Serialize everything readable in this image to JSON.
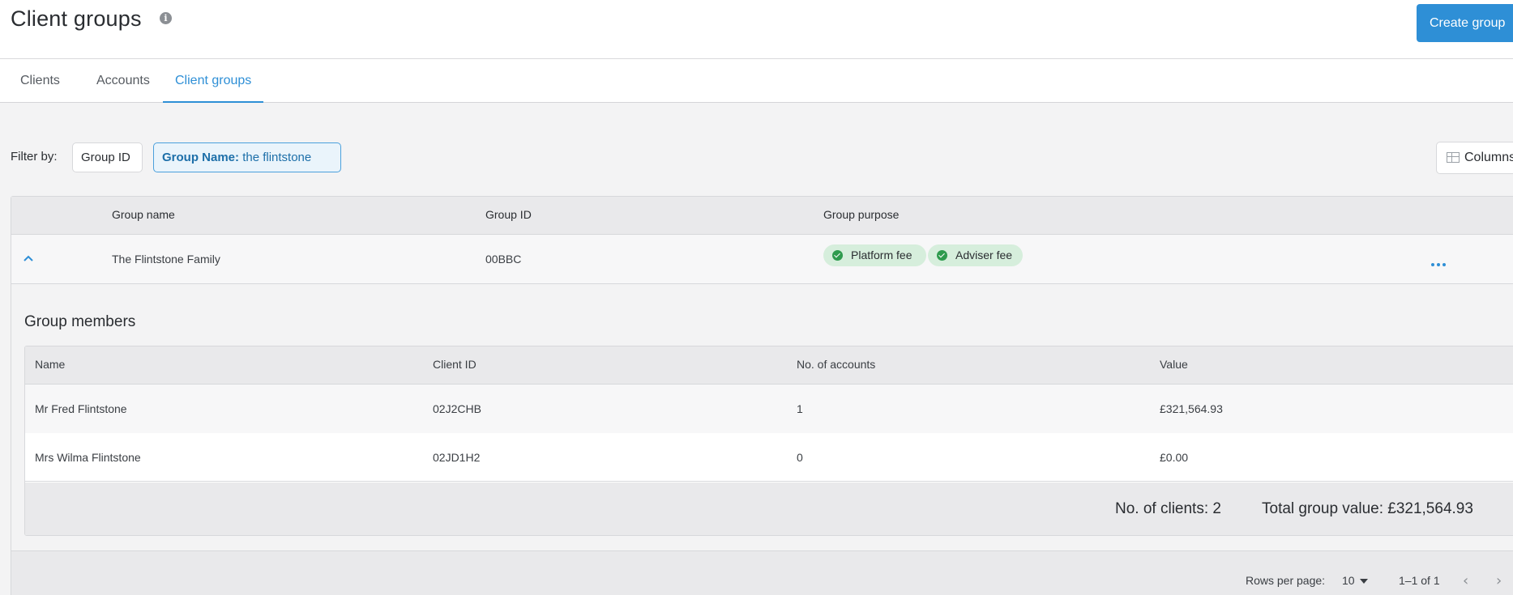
{
  "header": {
    "title": "Client groups",
    "info_icon": "info-icon",
    "create_label": "Create group"
  },
  "tabs": [
    {
      "label": "Clients"
    },
    {
      "label": "Accounts"
    },
    {
      "label": "Client groups",
      "active": true
    }
  ],
  "filters": {
    "label": "Filter by:",
    "chips": [
      {
        "label": "Group ID"
      },
      {
        "key": "Group Name:",
        "value": "the flintstone"
      }
    ],
    "columns_label": "Columns"
  },
  "table": {
    "headers": [
      "Group name",
      "Group ID",
      "Group purpose"
    ],
    "group": {
      "name": "The Flintstone Family",
      "id": "00BBC",
      "purposes": [
        "Platform fee",
        "Adviser fee"
      ]
    }
  },
  "members": {
    "title": "Group members",
    "headers": [
      "Name",
      "Client ID",
      "No. of accounts",
      "Value"
    ],
    "rows": [
      {
        "name": "Mr Fred Flintstone",
        "client_id": "02J2CHB",
        "accounts": "1",
        "value": "£321,564.93"
      },
      {
        "name": "Mrs Wilma Flintstone",
        "client_id": "02JD1H2",
        "accounts": "0",
        "value": "£0.00"
      }
    ],
    "summary": {
      "clients": "No. of clients: 2",
      "total": "Total group value: £321,564.93"
    }
  },
  "pagination": {
    "rows_label": "Rows per page:",
    "rows_value": "10",
    "range": "1–1 of 1"
  },
  "colors": {
    "accent": "#2e8fd6",
    "badge_bg": "#d6eedc",
    "check": "#2f9b4e"
  }
}
